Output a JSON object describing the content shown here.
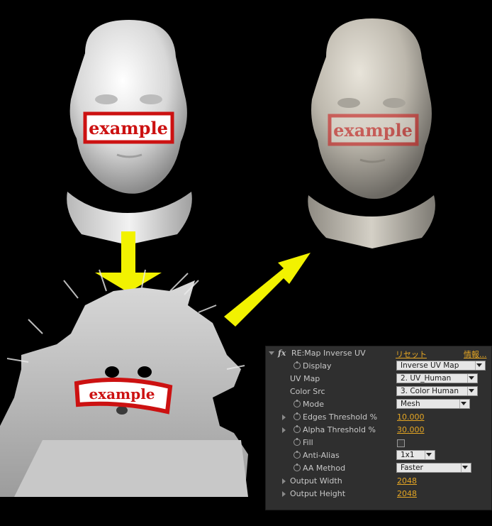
{
  "images": {
    "source_head": {
      "label": "example"
    },
    "uv_map": {
      "label": "example"
    },
    "result_head": {
      "label": "example"
    }
  },
  "colors": {
    "label_red": "#cc1111",
    "arrow_yellow": "#f2f200"
  },
  "panel": {
    "effect_name": "RE:Map Inverse UV",
    "reset_link": "リセット",
    "info_link": "情報...",
    "rows": [
      {
        "label": "Display",
        "value": "Inverse UV Map"
      },
      {
        "label": "UV Map",
        "value": "2. UV_Human"
      },
      {
        "label": "Color Src",
        "value": "3. Color Human"
      },
      {
        "label": "Mode",
        "value": "Mesh"
      },
      {
        "label": "Edges Threshold %",
        "value": "10.000"
      },
      {
        "label": "Alpha Threshold %",
        "value": "30.000"
      },
      {
        "label": "Fill",
        "value": ""
      },
      {
        "label": "Anti-Alias",
        "value": "1x1"
      },
      {
        "label": "AA Method",
        "value": "Faster"
      },
      {
        "label": "Output Width",
        "value": "2048"
      },
      {
        "label": "Output Height",
        "value": "2048"
      }
    ]
  }
}
